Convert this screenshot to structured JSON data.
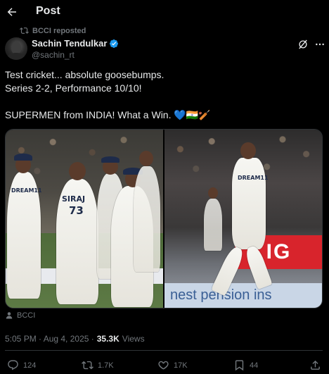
{
  "header": {
    "title": "Post"
  },
  "repost": {
    "text": "BCCI reposted"
  },
  "author": {
    "name": "Sachin Tendulkar",
    "handle": "@sachin_rt",
    "verified": true
  },
  "post": {
    "lines": [
      "Test cricket... absolute goosebumps.",
      "Series 2-2, Performance 10/10!",
      "",
      "SUPERMEN from INDIA! What a Win. 💙🇮🇳🏏"
    ]
  },
  "media": {
    "left_jersey_name": "SIRAJ",
    "left_jersey_number": "73",
    "left_jersey_sponsor": "DREAM11",
    "right_jersey_sponsor": "DREAM11",
    "right_board_text": "IG",
    "right_bottom_board_text": "nest pension ins"
  },
  "credit": {
    "label": "BCCI"
  },
  "meta": {
    "time": "5:05 PM · Aug 4, 2025 ·",
    "views_count": "35.3K",
    "views_label": "Views"
  },
  "actions": {
    "replies": "124",
    "reposts": "1.7K",
    "likes": "17K",
    "bookmarks": "44"
  },
  "colors": {
    "background": "#000000",
    "text": "#e7e9ea",
    "muted": "#71767b",
    "verified": "#1d9bf0"
  }
}
